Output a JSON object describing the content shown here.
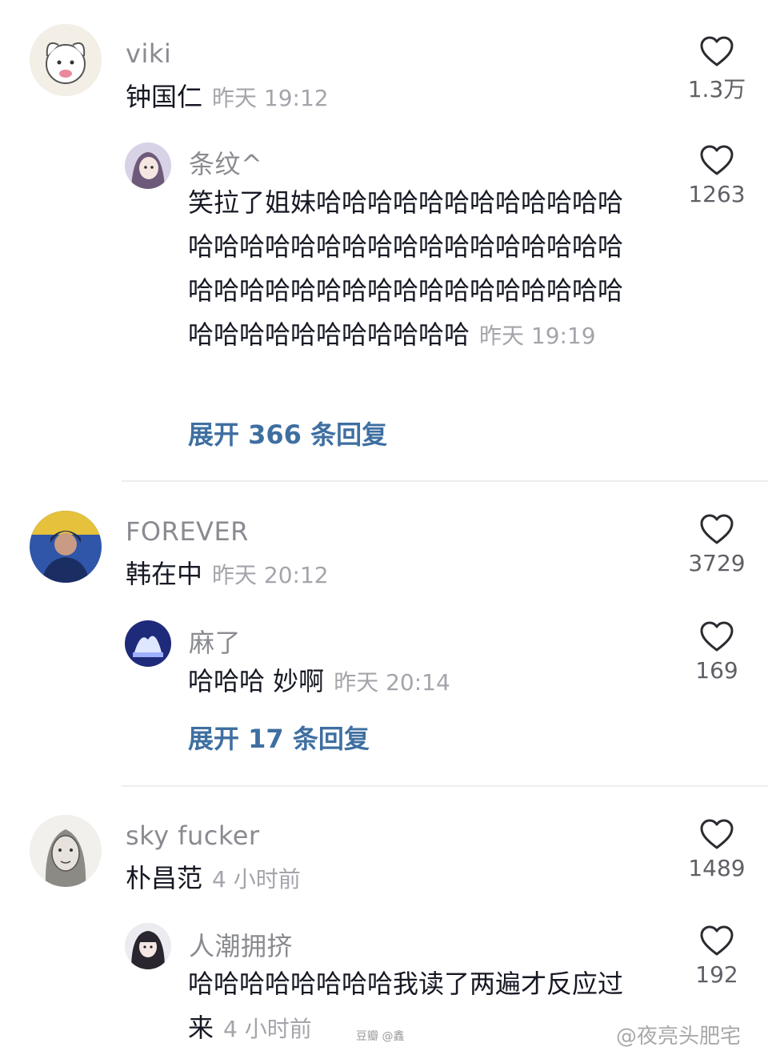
{
  "threads": [
    {
      "main": {
        "username": "viki",
        "text": "钟国仁",
        "time": "昨天 19:12",
        "likes": "1.3万"
      },
      "reply": {
        "username": "条纹^",
        "text": "笑拉了姐妹哈哈哈哈哈哈哈哈哈哈哈哈哈哈哈哈哈哈哈哈哈哈哈哈哈哈哈哈哈哈哈哈哈哈哈哈哈哈哈哈哈哈哈哈哈哈哈哈哈哈哈哈哈哈哈哈哈",
        "time": "昨天 19:19",
        "likes": "1263"
      },
      "expand": "展开 366 条回复"
    },
    {
      "main": {
        "username": "FOREVER",
        "text": "韩在中",
        "time": "昨天 20:12",
        "likes": "3729"
      },
      "reply": {
        "username": "麻了",
        "text": "哈哈哈 妙啊",
        "time": "昨天 20:14",
        "likes": "169"
      },
      "expand": "展开 17 条回复"
    },
    {
      "main": {
        "username": "sky fucker",
        "text": "朴昌范",
        "time": "4 小时前",
        "likes": "1489"
      },
      "reply": {
        "username": "人潮拥挤",
        "text": "哈哈哈哈哈哈哈哈我读了两遍才反应过来",
        "time": "4 小时前",
        "likes": "192"
      }
    }
  ],
  "watermarks": {
    "small": "豆瓣 @鑫",
    "weibo": "@夜亮头肥宅"
  },
  "icons": {
    "like": "heart-outline-icon"
  },
  "colors": {
    "username": "#8a8b91",
    "text": "#161823",
    "time": "#a4a5ab",
    "expand": "#3f6fa1",
    "divider": "#eeeeef"
  }
}
